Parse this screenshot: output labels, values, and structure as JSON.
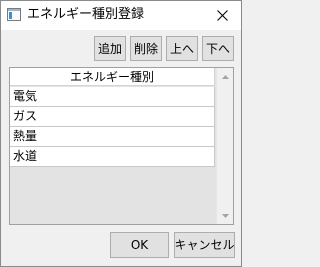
{
  "window": {
    "title": "エネルギー種別登録"
  },
  "toolbar": {
    "add_label": "追加",
    "delete_label": "削除",
    "up_label": "上へ",
    "down_label": "下へ"
  },
  "table": {
    "column_header": "エネルギー種別",
    "rows": [
      "電気",
      "ガス",
      "熱量",
      "水道"
    ]
  },
  "footer": {
    "ok_label": "OK",
    "cancel_label": "キャンセル"
  },
  "icons": {
    "app": "window-app-icon",
    "close": "close-icon",
    "scroll_up": "scroll-up-arrow-icon",
    "scroll_down": "scroll-down-arrow-icon"
  },
  "colors": {
    "titlebar": "#ffffff",
    "window_bg": "#f0f0f0",
    "button_bg": "#e1e1e1",
    "table_empty_bg": "#e3e3e3"
  }
}
